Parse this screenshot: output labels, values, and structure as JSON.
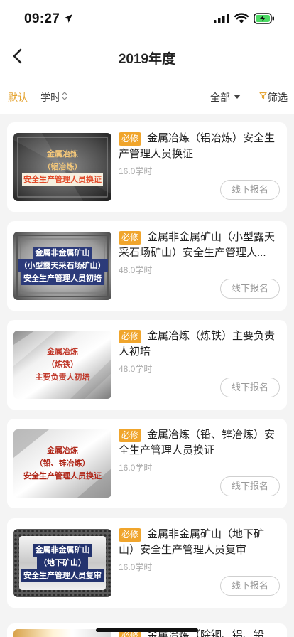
{
  "status_bar": {
    "time": "09:27"
  },
  "header": {
    "title": "2019年度"
  },
  "filters": {
    "default": "默认",
    "hours": "学时",
    "all": "全部",
    "screen": "筛选"
  },
  "accent_color": "#f0a52c",
  "courses": [
    {
      "thumb_lines": [
        "金属冶炼",
        "（铝冶炼）",
        "安全生产管理人员换证"
      ],
      "badge": "必修",
      "title": "金属冶炼（铝冶炼）安全生产管理人员换证",
      "hours": "16.0学时",
      "action": "线下报名"
    },
    {
      "thumb_lines": [
        "金属非金属矿山",
        "（小型露天采石场矿山）",
        "安全生产管理人员初培"
      ],
      "badge": "必修",
      "title": "金属非金属矿山（小型露天采石场矿山）安全生产管理人...",
      "hours": "48.0学时",
      "action": "线下报名"
    },
    {
      "thumb_lines": [
        "金属冶炼",
        "（炼铁）",
        "主要负责人初培"
      ],
      "badge": "必修",
      "title": "金属冶炼（炼铁）主要负责人初培",
      "hours": "48.0学时",
      "action": "线下报名"
    },
    {
      "thumb_lines": [
        "金属冶炼",
        "（铅、锌冶炼）",
        "安全生产管理人员换证"
      ],
      "badge": "必修",
      "title": "金属冶炼（铅、锌冶炼）安全生产管理人员换证",
      "hours": "16.0学时",
      "action": "线下报名"
    },
    {
      "thumb_lines": [
        "金属非金属矿山",
        "（地下矿山）",
        "安全生产管理人员复审"
      ],
      "badge": "必修",
      "title": "金属非金属矿山（地下矿山）安全生产管理人员复审",
      "hours": "16.0学时",
      "action": "线下报名"
    }
  ],
  "partial_course": {
    "badge": "必修",
    "title": "金属冶炼（除铜、铝、铅"
  }
}
